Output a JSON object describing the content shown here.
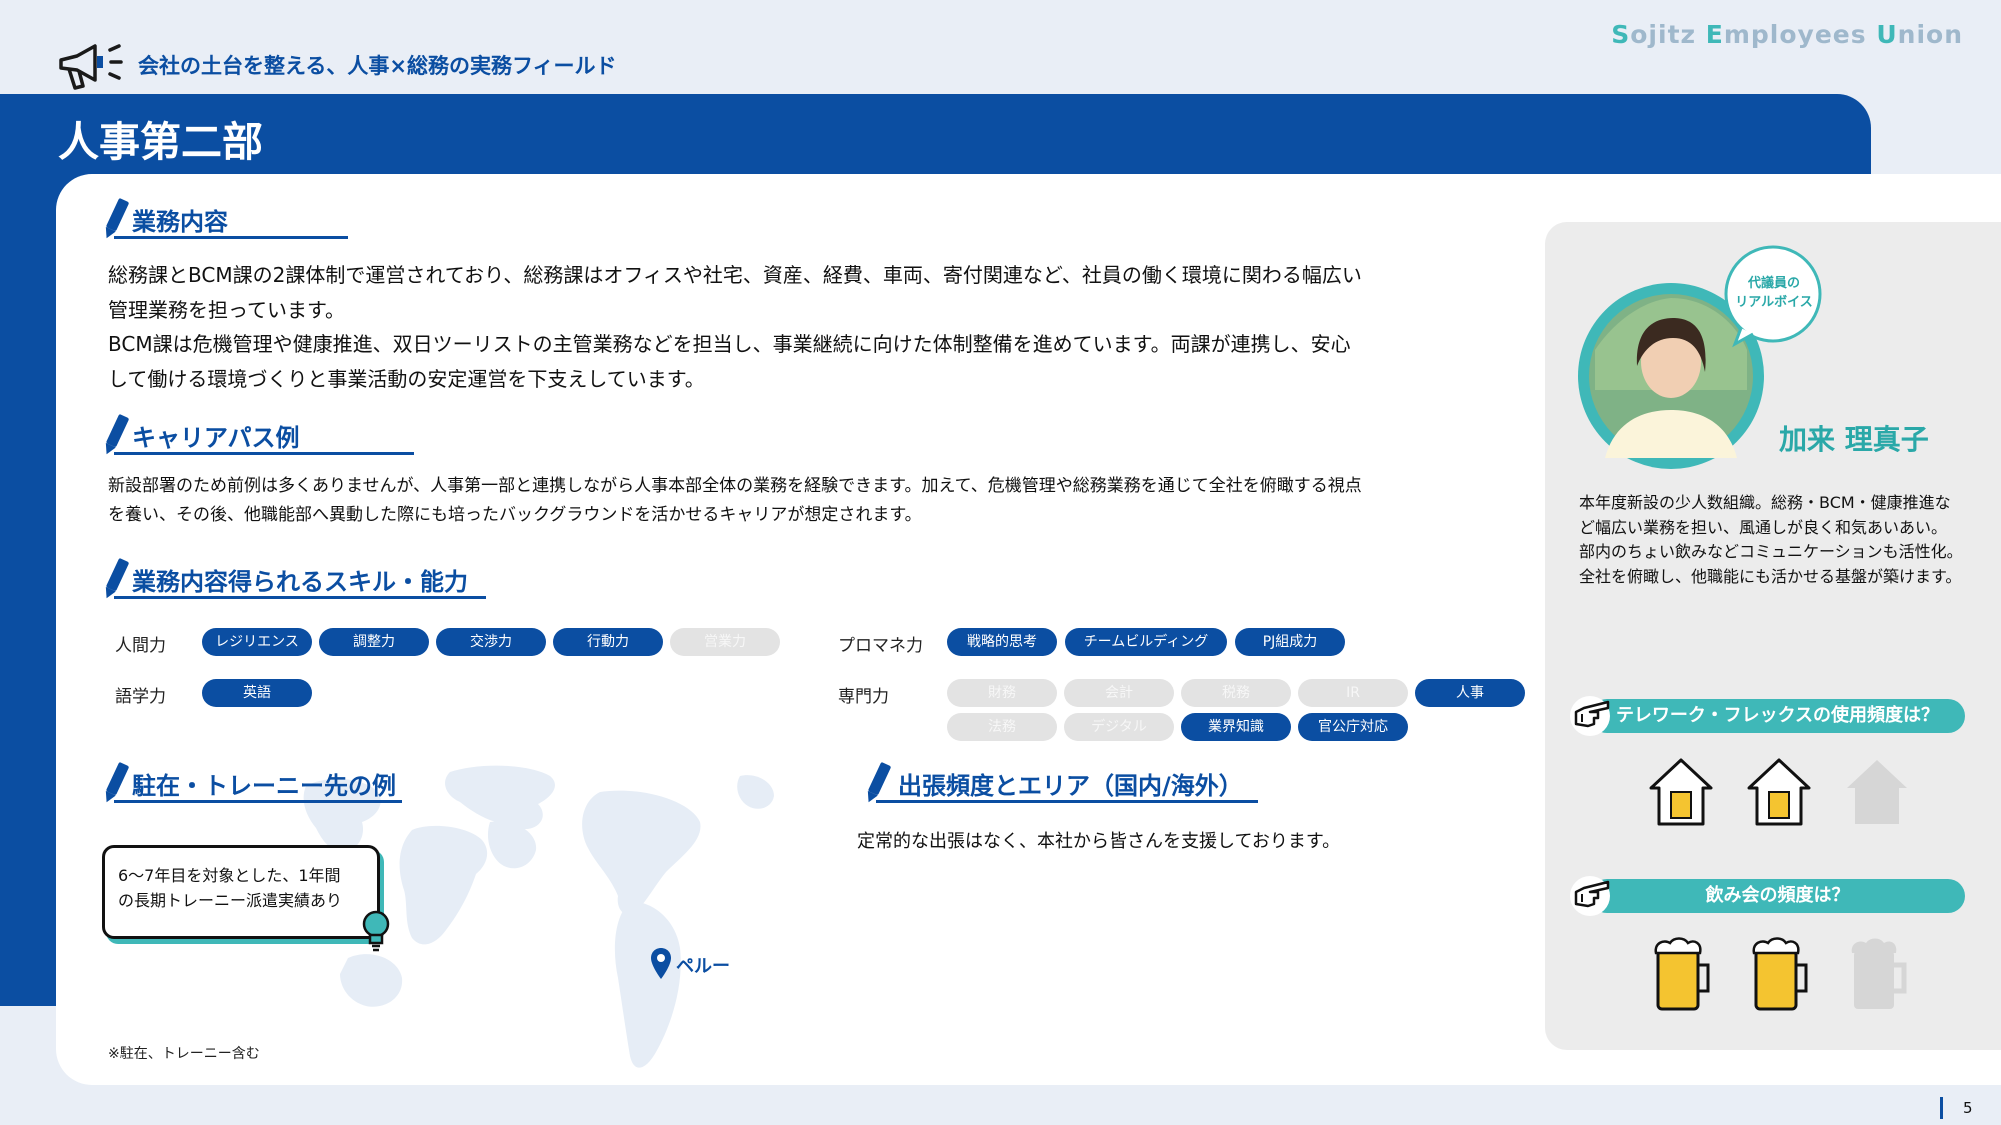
{
  "brand": {
    "s": "S",
    "ojitz": "ojitz ",
    "e": "E",
    "mployees": "mployees ",
    "u": "U",
    "nion": "nion"
  },
  "header": {
    "tagline": "会社の土台を整える、人事×総務の実務フィールド",
    "title": "人事第二部"
  },
  "sections": {
    "work": {
      "title": "業務内容",
      "lines": [
        "総務課とBCM課の2課体制で運営されており、総務課はオフィスや社宅、資産、経費、車両、寄付関連など、社員の働く環境に関わる幅広い",
        "管理業務を担っています。",
        "BCM課は危機管理や健康推進、双日ツーリストの主管業務などを担当し、事業継続に向けた体制整備を進めています。両課が連携し、安心",
        "して働ける環境づくりと事業活動の安定運営を下支えしています。"
      ]
    },
    "career": {
      "title": "キャリアパス例",
      "lines": [
        "新設部署のため前例は多くありませんが、人事第一部と連携しながら人事本部全体の業務を経験できます。加えて、危機管理や総務業務を通じて全社を俯瞰する視点",
        "を養い、その後、他職能部へ異動した際にも培ったバックグラウンドを活かせるキャリアが想定されます。"
      ]
    },
    "skills": {
      "title": "業務内容得られるスキル・能力"
    },
    "overseas": {
      "title": "駐在・トレーニー先の例",
      "bubble": [
        "6～7年目を対象とした、1年間",
        "の長期トレーニー派遣実績あり"
      ],
      "location": "ペルー",
      "footnote": "※駐在、トレーニー含む"
    },
    "trip": {
      "title": "出張頻度とエリア（国内/海外）",
      "text": "定常的な出張はなく、本社から皆さんを支援しております。"
    }
  },
  "skill_groups": {
    "human": {
      "label": "人間力",
      "pills": [
        {
          "text": "レジリエンス",
          "on": true
        },
        {
          "text": "調整力",
          "on": true
        },
        {
          "text": "交渉力",
          "on": true
        },
        {
          "text": "行動力",
          "on": true
        },
        {
          "text": "営業力",
          "on": false
        }
      ]
    },
    "language": {
      "label": "語学力",
      "pills": [
        {
          "text": "英語",
          "on": true
        }
      ]
    },
    "promane": {
      "label": "プロマネ力",
      "pills": [
        {
          "text": "戦略的思考",
          "on": true
        },
        {
          "text": "チームビルディング",
          "on": true
        },
        {
          "text": "PJ組成力",
          "on": true
        }
      ]
    },
    "expert": {
      "label": "専門力",
      "pills": [
        {
          "text": "財務",
          "on": false
        },
        {
          "text": "会計",
          "on": false
        },
        {
          "text": "税務",
          "on": false
        },
        {
          "text": "IR",
          "on": false
        },
        {
          "text": "人事",
          "on": true
        },
        {
          "text": "法務",
          "on": false
        },
        {
          "text": "デジタル",
          "on": false
        },
        {
          "text": "業界知識",
          "on": true
        },
        {
          "text": "官公庁対応",
          "on": true
        }
      ]
    }
  },
  "panel": {
    "badge": [
      "代議員の",
      "リアルボイス"
    ],
    "name": "加来 理真子",
    "voice": [
      "本年度新設の少人数組織。総務・BCM・健康推進な",
      "ど幅広い業務を担い、風通しが良く和気あいあい。",
      "部内のちょい飲みなどコミュニケーションも活性化。",
      "全社を俯瞰し、他職能にも活かせる基盤が築けます。"
    ],
    "q_telework": "テレワーク・フレックスの使用頻度は？",
    "telework_level": 2,
    "telework_max": 3,
    "q_drink": "飲み会の頻度は？",
    "drink_level": 2,
    "drink_max": 3
  },
  "page": {
    "number": "5"
  },
  "colors": {
    "primary": "#0b4ea2",
    "teal": "#3fb8b8",
    "off": "#e3e3e3"
  }
}
